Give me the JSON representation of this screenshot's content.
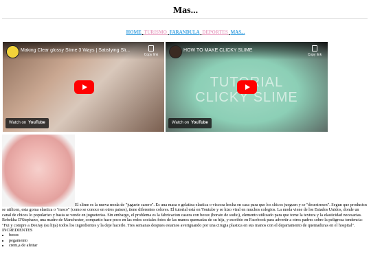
{
  "site": {
    "title": "Mas..."
  },
  "nav": {
    "items": [
      {
        "label": "HOME"
      },
      {
        "label": "TURISMO"
      },
      {
        "label": "FARANDULA"
      },
      {
        "label": "DEPORTES"
      },
      {
        "label": "MAS..."
      }
    ]
  },
  "videos": [
    {
      "title": "Making Clear glossy Slime 3 Ways | Satisfying Sli...",
      "copy_label": "Copy link",
      "watch_on": "Watch on",
      "platform": "YouTube"
    },
    {
      "title": "HOW TO MAKE CLICKY SLIME",
      "copy_label": "Copy link",
      "watch_on": "Watch on",
      "platform": "YouTube",
      "overlay_line1": "TUTORIAL",
      "overlay_line2": "CLICKY SLIME"
    }
  ],
  "article": {
    "text": "El slime es la nueva moda de \"juguete casero\". Es una masa o gelatina elastica o viscosa hecha en casa para que los chicos jueguen y se \"desestresen\". Segun que productos se utilicen, esta goma elastica o \"moco\" (como se conoce en otros paises), tiene diferentes colores. El tutorial está en Youtube y se hizo viral en muchos colegios. La moda viene de los Estados Unidos, donde un canal de chicos lo popularizo y hasta se vende en jugueterias. Sin embargo, el problema es la fabricacion casera con borax (borato de sodio), elemento utilizado para que tome la textura y la elasticidad necesarias. Rebekha D'Stephano, una madre de Manchester, compartio hace poco en las redes sociales fotos de las manos quemadas de su hija, y escribio en Facebook para advertir a otros padres sobre la peligrosa tendencia: \"Fui y compre a DeeJay (su hija) todos los ingredientes y la deje hacerlo. Tres semanas despues estamos averiguando por una cirugia plastica en sus manos con el departamento de quemaduras en el hospital\". INCREDIENTES",
    "ingredients": [
      "borax",
      "pegamento",
      "crem,a de afeitar"
    ]
  }
}
